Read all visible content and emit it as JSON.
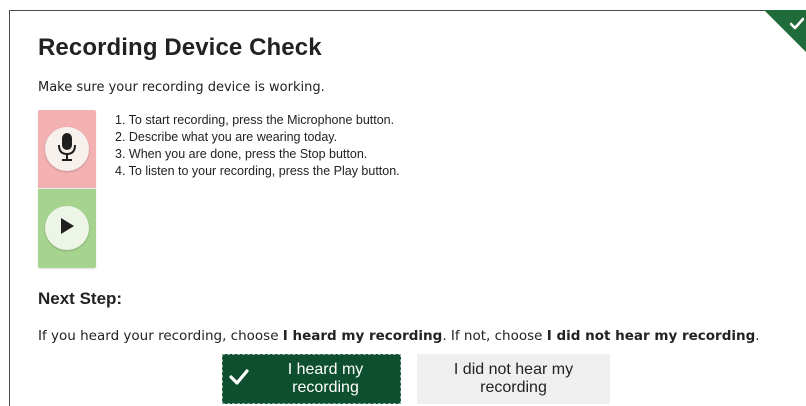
{
  "page": {
    "title": "Recording Device Check",
    "intro": "Make sure your recording device is working.",
    "instructions": [
      "1. To start recording, press the Microphone button.",
      "2. Describe what you are wearing today.",
      "3. When you are done, press the Stop button.",
      "4. To listen to your recording, press the Play button."
    ],
    "next_step_heading": "Next Step:",
    "next_step_text": {
      "part1": "If you heard your recording, choose ",
      "part2": "I heard my recording",
      "part3": ". If not, choose ",
      "part4": "I did not hear my recording",
      "part5": "."
    }
  },
  "buttons": {
    "heard_label": "I heard my recording",
    "not_heard_label": "I did not hear my recording"
  },
  "icons": {
    "corner": "check-icon",
    "mic": "microphone-icon",
    "play": "play-icon",
    "button_check": "check-icon"
  },
  "colors": {
    "accent": "#0d4f2f",
    "mic_panel": "#f3b1b1",
    "play_panel": "#a6d48f",
    "secondary_button": "#efefef"
  }
}
